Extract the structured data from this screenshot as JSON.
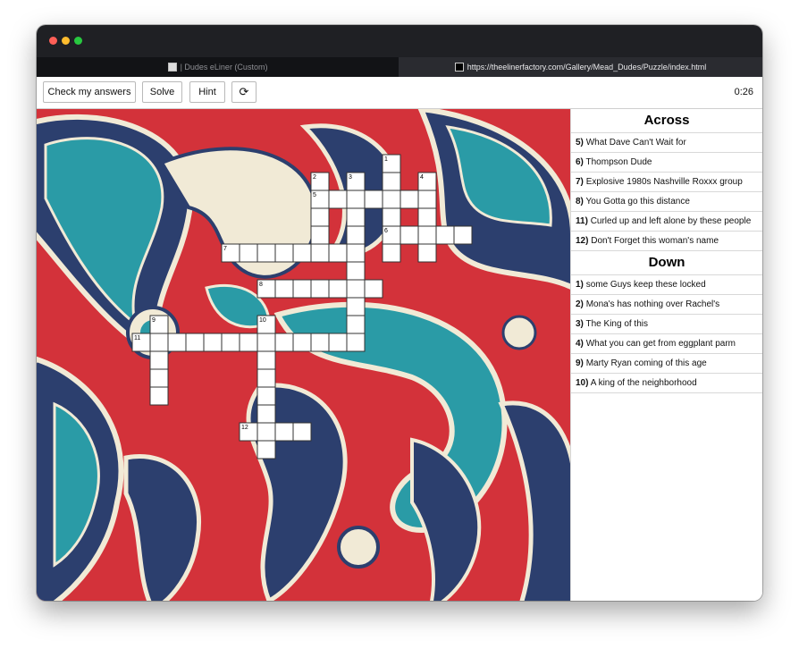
{
  "browser": {
    "tabs": [
      {
        "label": "| Dudes eLiner (Custom)"
      },
      {
        "label": "https://theelinerfactory.com/Gallery/Mead_Dudes/Puzzle/index.html"
      }
    ]
  },
  "toolbar": {
    "check_label": "Check my answers",
    "solve_label": "Solve",
    "hint_label": "Hint",
    "reset_label": "⟳",
    "timer": "0:26"
  },
  "colors": {
    "paisley_red": "#d3323a",
    "paisley_navy": "#2c3f6e",
    "paisley_teal": "#2a9ba6",
    "paisley_cream": "#f1ead6",
    "titlebar": "#1f2024"
  },
  "clues": {
    "across_title": "Across",
    "down_title": "Down",
    "across": [
      {
        "num": "5)",
        "text": "What Dave Can't Wait for"
      },
      {
        "num": "6)",
        "text": "Thompson Dude"
      },
      {
        "num": "7)",
        "text": "Explosive 1980s Nashville Roxxx group"
      },
      {
        "num": "8)",
        "text": "You Gotta go this distance"
      },
      {
        "num": "11)",
        "text": "Curled up and left alone by these people"
      },
      {
        "num": "12)",
        "text": "Don't Forget this woman's name"
      }
    ],
    "down": [
      {
        "num": "1)",
        "text": "some Guys keep these locked"
      },
      {
        "num": "2)",
        "text": "Mona's has nothing over Rachel's"
      },
      {
        "num": "3)",
        "text": "The King of this"
      },
      {
        "num": "4)",
        "text": "What you can get from eggplant parm"
      },
      {
        "num": "9)",
        "text": "Marty Ryan coming of this age"
      },
      {
        "num": "10)",
        "text": "A king of the neighborhood"
      }
    ]
  },
  "grid": {
    "numbers": [
      "1",
      "2",
      "3",
      "4",
      "5",
      "6",
      "7",
      "8",
      "9",
      "10",
      "11",
      "12"
    ]
  }
}
